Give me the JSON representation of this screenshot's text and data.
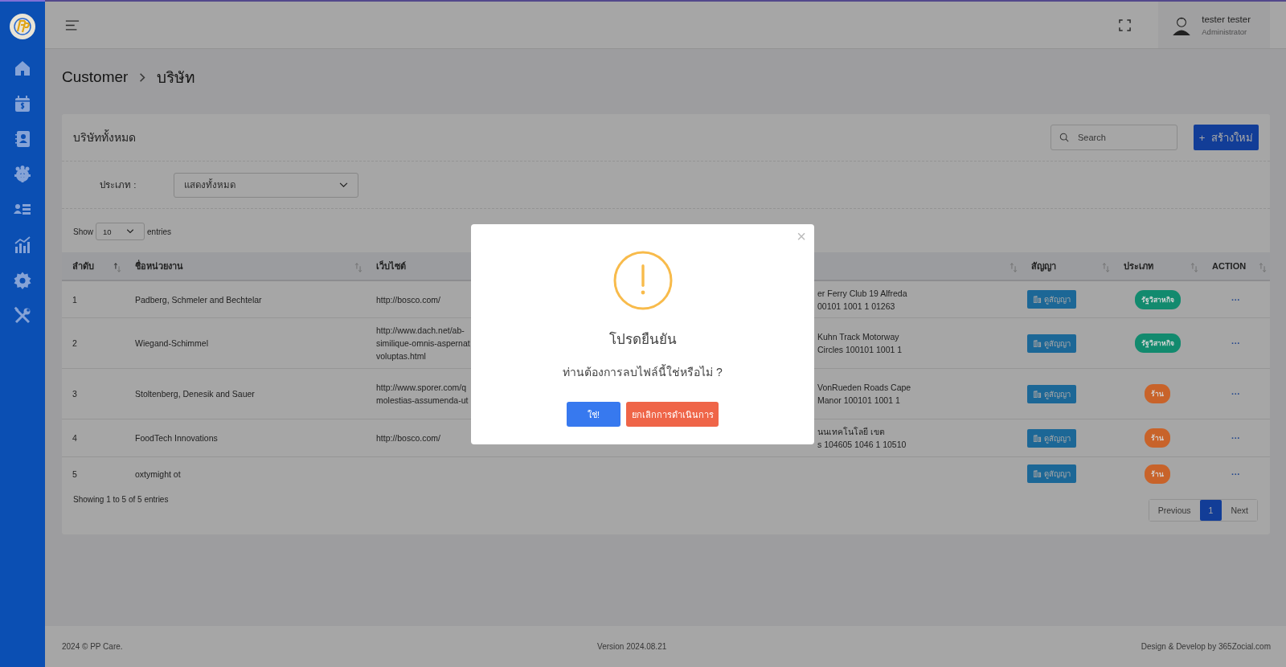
{
  "header": {
    "user": {
      "name": "tester tester",
      "role": "Administrator"
    }
  },
  "breadcrumb": [
    "Customer",
    "บริษัท"
  ],
  "card": {
    "title": "บริษัททั้งหมด",
    "search": {
      "placeholder": "Search"
    },
    "create_button": {
      "icon": "+",
      "label": "สร้างใหม่"
    }
  },
  "filter": {
    "label": "ประเภท :",
    "value": "แสดงทั้งหมด"
  },
  "page_length": {
    "prefix": "Show",
    "value": "10",
    "suffix": "entries"
  },
  "table": {
    "columns": [
      {
        "label": "ลำดับ",
        "sorted": true
      },
      {
        "label": "ชื่อหน่วยงาน",
        "sorted": false
      },
      {
        "label": "เว็บไซต์"
      },
      {
        "sorted": false
      },
      {
        "label": "สัญญา",
        "sorted": false
      },
      {
        "label": "ประเภท",
        "sorted": false
      },
      {
        "label": "ACTION",
        "sorted": false
      }
    ],
    "rows": [
      {
        "no": "1",
        "name": "Padberg, Schmeler and Bechtelar",
        "website": [
          "http://bosco.com/"
        ],
        "address": [
          "er Ferry Club 19 Alfreda",
          "00101 1001 1 01263"
        ],
        "contract": "ดูสัญญา",
        "type": {
          "label": "รัฐวิสาหกิจ",
          "color": "#128a6e"
        },
        "action": "···"
      },
      {
        "no": "2",
        "name": "Wiegand-Schimmel",
        "website": [
          "http://www.dach.net/ab-",
          "similique-omnis-aspernat",
          "voluptas.html"
        ],
        "address": [
          "Kuhn Track Motorway",
          "Circles 100101 1001 1"
        ],
        "contract": "ดูสัญญา",
        "type": {
          "label": "รัฐวิสาหกิจ",
          "color": "#128a6e"
        },
        "action": "···"
      },
      {
        "no": "3",
        "name": "Stoltenberg, Denesik and Sauer",
        "website": [
          "http://www.sporer.com/q",
          "molestias-assumenda-ut"
        ],
        "address": [
          "VonRueden Roads Cape",
          "Manor 100101 1001 1"
        ],
        "contract": "ดูสัญญา",
        "type": {
          "label": "ร้าน",
          "color": "#c8632a"
        },
        "action": "···"
      },
      {
        "no": "4",
        "name": "FoodTech Innovations",
        "website": [
          "http://bosco.com/"
        ],
        "address": [
          "นนเทคโนโลยี เขต",
          "s 104605 1046 1 10510"
        ],
        "contract": "ดูสัญญา",
        "type": {
          "label": "ร้าน",
          "color": "#c8632a"
        },
        "action": "···"
      },
      {
        "no": "5",
        "name": "oxtymight ot",
        "contract": "ดูสัญญา",
        "type": {
          "label": "ร้าน",
          "color": "#c8632a"
        },
        "action": "···"
      }
    ]
  },
  "info": "Showing 1 to 5 of 5 entries",
  "pagination": [
    {
      "label": "Previous",
      "selected": false
    },
    {
      "label": "1",
      "selected": true
    },
    {
      "label": "Next",
      "selected": false
    }
  ],
  "footer": {
    "copyright": "2024 © PP Care.",
    "version": "Version 2024.08.21",
    "credit": "Design & Develop by 365Zocial.com"
  },
  "modal": {
    "close": "×",
    "title": "โปรดยืนยัน",
    "message": "ท่านต้องการลบไฟล์นี้ใช่หรือไม่ ?",
    "buttons": [
      {
        "label": "ใช่!",
        "kind": "confirm"
      },
      {
        "label": "ยกเลิกการดำเนินการ",
        "kind": "cancel"
      }
    ]
  }
}
